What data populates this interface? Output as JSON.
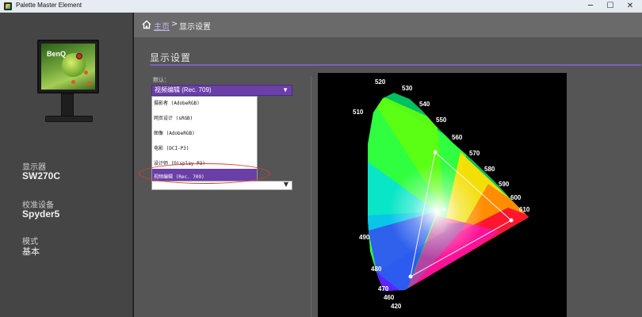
{
  "window": {
    "title": "Palette Master Element",
    "min": "─",
    "max": "☐",
    "close": "✕"
  },
  "sidebar": {
    "brand": "BenQ",
    "display_label": "显示器",
    "display_value": "SW270C",
    "calibration_label": "校准设备",
    "calibration_value": "Spyder5",
    "mode_label": "模式",
    "mode_value": "基本"
  },
  "breadcrumb": {
    "home": "主页",
    "separator": ">",
    "current": "显示设置"
  },
  "section": {
    "title": "显示设置"
  },
  "form": {
    "default_label": "默认：",
    "selected_value": "视频编辑 (Rec. 709)",
    "options": [
      "摄影者 (AdobeRGB)",
      "网页设计 (sRGB)",
      "图像 (AdobeRGB)",
      "电影 (DCI-P3)",
      "设计师 (Display P3)",
      "视频编辑 (Rec. 709)"
    ],
    "highlighted_option": "视频编辑 (Rec. 709)"
  },
  "chart_data": {
    "type": "chromaticity-diagram",
    "wavelength_labels": [
      "520",
      "530",
      "540",
      "510",
      "550",
      "560",
      "570",
      "580",
      "590",
      "600",
      "610",
      "490",
      "480",
      "470",
      "460",
      "420"
    ],
    "gamut_triangle": "Rec. 709"
  }
}
